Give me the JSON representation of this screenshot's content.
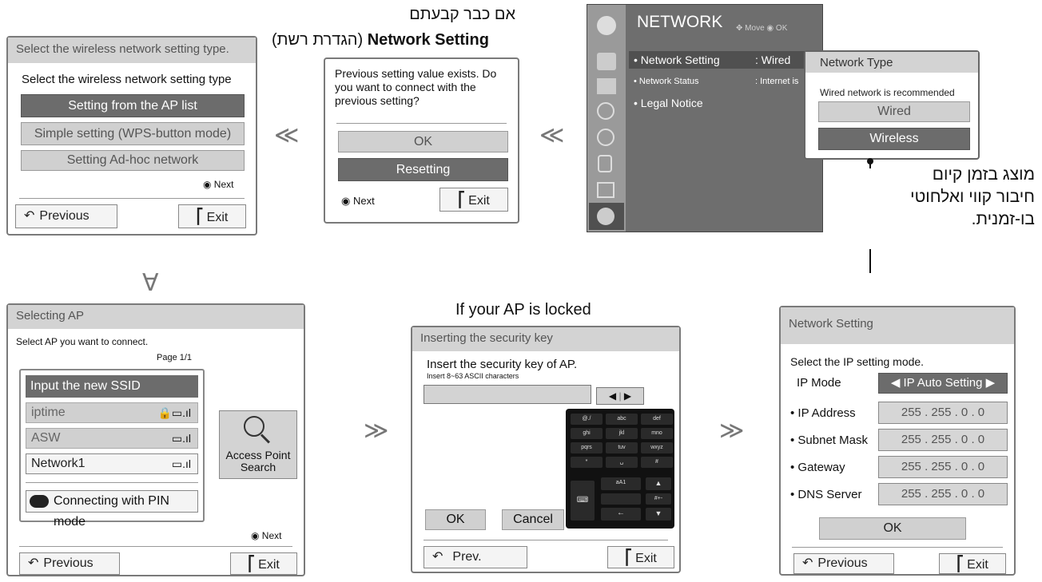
{
  "captions": {
    "top_line1": "אם כבר קבעתם",
    "top_line2_bold": "Network Setting",
    "top_line2_rest": "(הגדרת רשת)",
    "mid_caption": "If your AP is locked",
    "side_line1": "מוצג בזמן קיום",
    "side_line2": "חיבור קווי ואלחוטי",
    "side_line3": "בו-זמנית."
  },
  "arrows": {
    "left": "≪",
    "right": "≫",
    "down": "∀"
  },
  "network_menu": {
    "title": "NETWORK",
    "hint_move": "Move",
    "hint_ok": "OK",
    "items": [
      {
        "label": "• Network Setting",
        "value": ": Wired"
      },
      {
        "label": "• Network Status",
        "value": ": Internet is"
      },
      {
        "label": "• Legal Notice",
        "value": ""
      }
    ],
    "popup": {
      "title": "Network Type",
      "subtitle": "Wired network is recommended",
      "option_wired": "Wired",
      "option_wireless": "Wireless"
    },
    "colors": {
      "bg": "#6e6e6e",
      "sidebar": "#9a9a9a",
      "active": "#505050"
    }
  },
  "prev_setting": {
    "message": "Previous setting value exists. Do you want to connect with the previous setting?",
    "ok": "OK",
    "resetting": "Resetting",
    "next": "◉ Next",
    "exit": "Exit"
  },
  "wireless_type": {
    "title": "Select the wireless network setting type.",
    "heading": "Select the wireless network setting type",
    "options": [
      "Setting from the AP list",
      "Simple setting (WPS-button mode)",
      "Setting Ad-hoc network"
    ],
    "next": "◉ Next",
    "previous": "Previous",
    "exit": "Exit"
  },
  "selecting_ap": {
    "title": "Selecting AP",
    "instruction": "Select AP you want to connect.",
    "page": "Page 1/1",
    "ssid_input": "Input the new SSID",
    "networks": [
      "iptime",
      "ASW",
      "Network1"
    ],
    "pin_mode": "Connecting with PIN mode",
    "search_line1": "Access Point",
    "search_line2": "Search",
    "next": "◉ Next",
    "previous": "Previous",
    "exit": "Exit"
  },
  "security_key": {
    "title": "Inserting the security key",
    "heading": "Insert the security key of AP.",
    "hint": "Insert 8~63 ASCII characters",
    "ok": "OK",
    "cancel": "Cancel",
    "prev": "Prev.",
    "exit": "Exit",
    "keys": [
      "@./",
      "abc",
      "def",
      "ghi",
      "jkl",
      "mno",
      "pqrs",
      "tuv",
      "wxyz",
      "*",
      "␣",
      "#"
    ],
    "special": "aA1",
    "sym": "#+-"
  },
  "network_setting": {
    "title": "Network Setting",
    "instruction": "Select the IP setting mode.",
    "ip_mode_label": "IP Mode",
    "ip_mode_value": "◀ IP Auto Setting ▶",
    "rows": [
      {
        "label": "• IP Address",
        "value": "255 . 255 . 0 . 0"
      },
      {
        "label": "• Subnet Mask",
        "value": "255 . 255 . 0 . 0"
      },
      {
        "label": "• Gateway",
        "value": "255 . 255 . 0 . 0"
      },
      {
        "label": "• DNS Server",
        "value": "255 . 255 . 0 . 0"
      }
    ],
    "ok": "OK",
    "previous": "Previous",
    "exit": "Exit"
  }
}
